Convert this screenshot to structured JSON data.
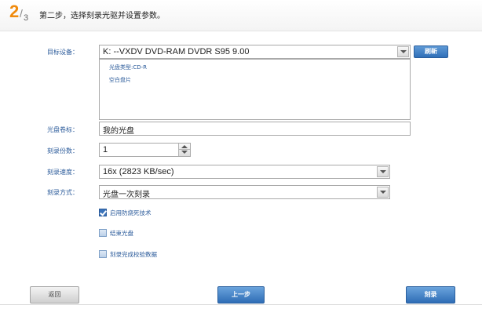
{
  "header": {
    "step_current": "2",
    "step_total": "3",
    "title": "第二步，选择刻录光驱并设置参数。"
  },
  "form": {
    "device_label": "目标设备：",
    "device_value": "K:  --VXDV     DVD-RAM DVDR S95 9.00",
    "refresh_label": "刷新",
    "disc_info": [
      "光盘类型:CD-R",
      "空白盘片"
    ],
    "volume_label": "光盘卷标：",
    "volume_value": "我的光盘",
    "copies_label": "刻录份数：",
    "copies_value": "1",
    "speed_label": "刻录速度：",
    "speed_value": "16x (2823 KB/sec)",
    "mode_label": "刻录方式：",
    "mode_value": "光盘一次刻录"
  },
  "options": [
    {
      "label": "启用防烧死技术",
      "checked": true
    },
    {
      "label": "结束光盘",
      "checked": false
    },
    {
      "label": "刻录完成校验数据",
      "checked": false
    }
  ],
  "footer": {
    "back_label": "返回",
    "prev_label": "上一步",
    "burn_label": "刻录"
  },
  "colors": {
    "accent_orange": "#f08a0c",
    "label_blue": "#2a5a9a",
    "button_blue": "#2e6db6"
  }
}
